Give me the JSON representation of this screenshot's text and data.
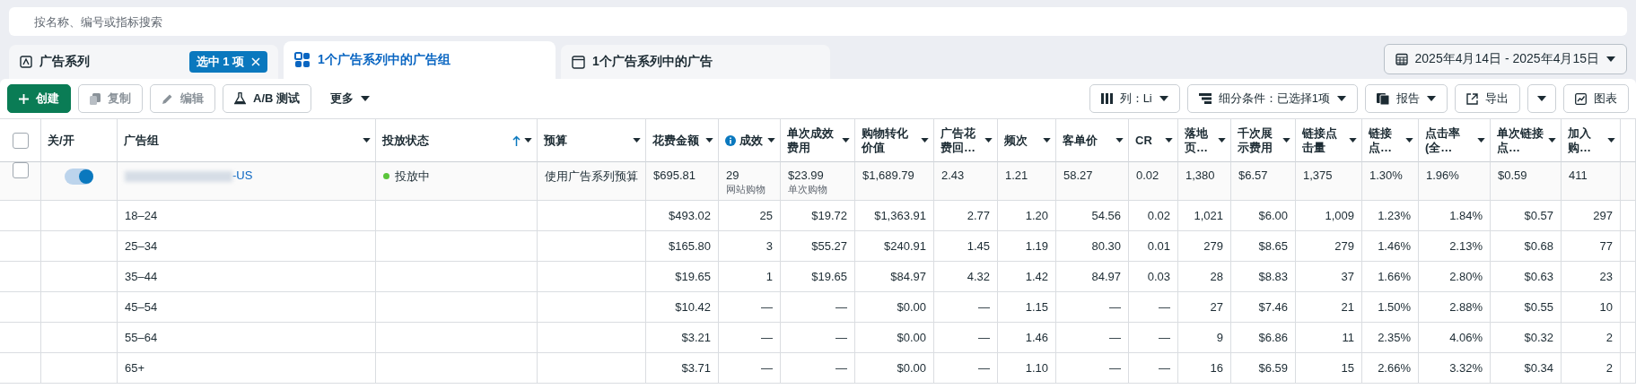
{
  "search": {
    "placeholder": "按名称、编号或指标搜索"
  },
  "tabs": [
    {
      "label": "广告系列",
      "selected": false,
      "badge": "选中 1 项"
    },
    {
      "label": "1个广告系列中的广告组",
      "selected": true
    },
    {
      "label": "1个广告系列中的广告",
      "selected": false
    }
  ],
  "date_range": "2025年4月14日 - 2025年4月15日",
  "toolbar_left": [
    {
      "kind": "primary",
      "label": "创建",
      "disabled": false
    },
    {
      "kind": "plain",
      "label": "复制",
      "disabled": true
    },
    {
      "kind": "plain",
      "label": "编辑",
      "disabled": true
    },
    {
      "kind": "plain",
      "label": "A/B 测试",
      "disabled": false
    },
    {
      "kind": "menu",
      "label": "更多",
      "disabled": false
    }
  ],
  "toolbar_right": [
    {
      "kind": "menu",
      "label": "列：Li"
    },
    {
      "kind": "menu",
      "label": "细分条件：已选择1项"
    },
    {
      "kind": "menu",
      "label": "报告"
    },
    {
      "kind": "plain",
      "label": "导出"
    },
    {
      "kind": "split"
    },
    {
      "kind": "plain",
      "label": "图表"
    }
  ],
  "table": {
    "select_all": false,
    "columns": [
      {
        "label": "关/开",
        "caret": false,
        "sorted": false,
        "info": false
      },
      {
        "label": "广告组",
        "caret": true,
        "sorted": false,
        "info": false
      },
      {
        "label": "投放状态",
        "caret": true,
        "sorted": true,
        "info": false
      },
      {
        "label": "预算",
        "caret": true,
        "sorted": false,
        "info": false
      },
      {
        "label": "花费金额",
        "caret": true,
        "sorted": false,
        "info": false
      },
      {
        "label": "成效",
        "caret": true,
        "sorted": false,
        "info": true
      },
      {
        "label": "单次成效费用",
        "caret": true,
        "sorted": false,
        "info": false
      },
      {
        "label": "购物转化价值",
        "caret": true,
        "sorted": false,
        "info": false
      },
      {
        "label": "广告花费回…",
        "caret": true,
        "sorted": false,
        "info": false
      },
      {
        "label": "频次",
        "caret": true,
        "sorted": false,
        "info": false
      },
      {
        "label": "客单价",
        "caret": true,
        "sorted": false,
        "info": false
      },
      {
        "label": "CR",
        "caret": true,
        "sorted": false,
        "info": false
      },
      {
        "label": "落地页…",
        "caret": true,
        "sorted": false,
        "info": false
      },
      {
        "label": "千次展示费用",
        "caret": true,
        "sorted": false,
        "info": false
      },
      {
        "label": "链接点击量",
        "caret": true,
        "sorted": false,
        "info": false
      },
      {
        "label": "链接点…",
        "caret": true,
        "sorted": false,
        "info": false
      },
      {
        "label": "点击率(全…",
        "caret": true,
        "sorted": false,
        "info": false
      },
      {
        "label": "单次链接点…",
        "caret": true,
        "sorted": false,
        "info": false
      },
      {
        "label": "加入购…",
        "caret": true,
        "sorted": false,
        "info": false
      }
    ],
    "rows": [
      {
        "kind": "adset",
        "checked": false,
        "on": true,
        "name": "-US",
        "status": "投放中",
        "color": "#5ac53a",
        "budget": "使用广告系列预算",
        "metrics": [
          "$695.81",
          {
            "value": "29",
            "note": "网站购物"
          },
          {
            "value": "$23.99",
            "note": "单次购物"
          },
          "$1,689.79",
          "2.43",
          "1.21",
          "58.27",
          "0.02",
          "1,380",
          "$6.57",
          "1,375",
          "1.30%",
          "1.96%",
          "$0.59",
          "411"
        ]
      },
      {
        "kind": "breakdown",
        "label": "18–24",
        "metrics": [
          "$493.02",
          "25",
          "$19.72",
          "$1,363.91",
          "2.77",
          "1.20",
          "54.56",
          "0.02",
          "1,021",
          "$6.00",
          "1,009",
          "1.23%",
          "1.84%",
          "$0.57",
          "297"
        ]
      },
      {
        "kind": "breakdown",
        "label": "25–34",
        "metrics": [
          "$165.80",
          "3",
          "$55.27",
          "$240.91",
          "1.45",
          "1.19",
          "80.30",
          "0.01",
          "279",
          "$8.65",
          "279",
          "1.46%",
          "2.13%",
          "$0.68",
          "77"
        ]
      },
      {
        "kind": "breakdown",
        "label": "35–44",
        "metrics": [
          "$19.65",
          "1",
          "$19.65",
          "$84.97",
          "4.32",
          "1.42",
          "84.97",
          "0.03",
          "28",
          "$8.83",
          "37",
          "1.66%",
          "2.80%",
          "$0.63",
          "23"
        ]
      },
      {
        "kind": "breakdown",
        "label": "45–54",
        "metrics": [
          "$10.42",
          "—",
          "—",
          "$0.00",
          "—",
          "1.15",
          "—",
          "—",
          "27",
          "$7.46",
          "21",
          "1.50%",
          "2.88%",
          "$0.55",
          "10"
        ]
      },
      {
        "kind": "breakdown",
        "label": "55–64",
        "metrics": [
          "$3.21",
          "—",
          "—",
          "$0.00",
          "—",
          "1.46",
          "—",
          "—",
          "9",
          "$6.86",
          "11",
          "2.35%",
          "4.06%",
          "$0.32",
          "2"
        ]
      },
      {
        "kind": "breakdown",
        "label": "65+",
        "metrics": [
          "$3.71",
          "—",
          "—",
          "$0.00",
          "—",
          "1.10",
          "—",
          "—",
          "16",
          "$6.59",
          "15",
          "2.66%",
          "3.32%",
          "$0.34",
          "2"
        ]
      }
    ]
  }
}
